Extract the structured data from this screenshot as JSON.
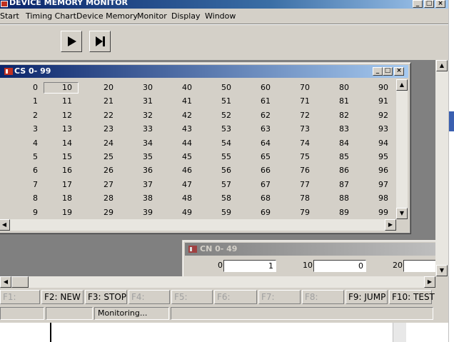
{
  "app": {
    "title": "DEVICE MEMORY MONITOR",
    "minimize_glyph": "_",
    "maximize_glyph": "□",
    "close_glyph": "×"
  },
  "menu": [
    "Start",
    "Timing Chart",
    "Device Memory",
    "Monitor",
    "Display",
    "Window"
  ],
  "toolbar": {
    "play_glyph": "▶",
    "step_glyph": "▶|"
  },
  "cs_window": {
    "title": "CS 0- 99",
    "row_labels": [
      "0",
      "1",
      "2",
      "3",
      "4",
      "5",
      "6",
      "7",
      "8",
      "9"
    ],
    "rows": [
      [
        "10",
        "20",
        "30",
        "40",
        "50",
        "60",
        "70",
        "80",
        "90"
      ],
      [
        "11",
        "21",
        "31",
        "41",
        "51",
        "61",
        "71",
        "81",
        "91"
      ],
      [
        "12",
        "22",
        "32",
        "42",
        "52",
        "62",
        "72",
        "82",
        "92"
      ],
      [
        "13",
        "23",
        "33",
        "43",
        "53",
        "63",
        "73",
        "83",
        "93"
      ],
      [
        "14",
        "24",
        "34",
        "44",
        "54",
        "64",
        "74",
        "84",
        "94"
      ],
      [
        "15",
        "25",
        "35",
        "45",
        "55",
        "65",
        "75",
        "85",
        "95"
      ],
      [
        "16",
        "26",
        "36",
        "46",
        "56",
        "66",
        "76",
        "86",
        "96"
      ],
      [
        "17",
        "27",
        "37",
        "47",
        "57",
        "67",
        "77",
        "87",
        "97"
      ],
      [
        "18",
        "28",
        "38",
        "48",
        "58",
        "68",
        "78",
        "88",
        "98"
      ],
      [
        "19",
        "29",
        "39",
        "49",
        "59",
        "69",
        "79",
        "89",
        "99"
      ]
    ]
  },
  "cn_window": {
    "title": "CN 0- 49",
    "fields": [
      {
        "label": "0",
        "value": "1"
      },
      {
        "label": "10",
        "value": "0"
      },
      {
        "label": "20",
        "value": ""
      }
    ]
  },
  "function_keys": [
    {
      "label": "F1:",
      "enabled": false
    },
    {
      "label": "F2: NEW",
      "enabled": true
    },
    {
      "label": "F3: STOP",
      "enabled": true
    },
    {
      "label": "F4:",
      "enabled": false
    },
    {
      "label": "F5:",
      "enabled": false
    },
    {
      "label": "F6:",
      "enabled": false
    },
    {
      "label": "F7:",
      "enabled": false
    },
    {
      "label": "F8:",
      "enabled": false
    },
    {
      "label": "F9: JUMP",
      "enabled": true
    },
    {
      "label": "F10: TEST",
      "enabled": true
    }
  ],
  "status": {
    "cells": [
      "",
      "",
      "Monitoring...",
      ""
    ]
  },
  "colors": {
    "title_active": "#0a246a",
    "face": "#d4d0c8",
    "mdi_bg": "#808080"
  }
}
